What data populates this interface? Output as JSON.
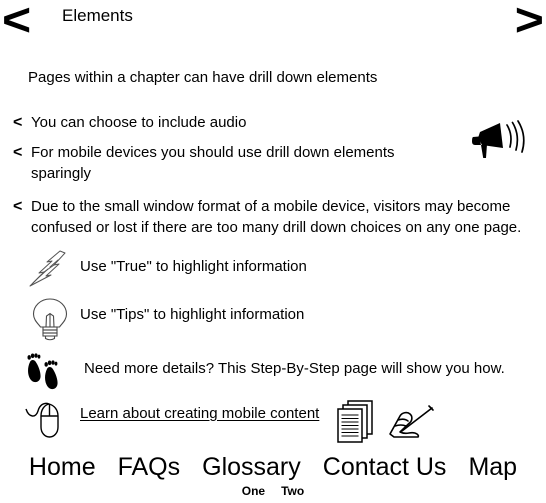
{
  "header": {
    "title": "Elements",
    "prev_arrow": "<",
    "next_arrow": ">",
    "prev_name": "previous-page-arrow",
    "next_name": "next-page-arrow"
  },
  "intro": {
    "text": "Pages within a chapter can have drill down elements"
  },
  "bullets": {
    "marker": "<",
    "items": [
      {
        "text": "You can choose to include audio"
      },
      {
        "text": "For mobile devices you should use drill down elements sparingly"
      },
      {
        "text": "Due to the small window format of a mobile device, visitors may become confused or lost if there are too many drill down choices on any one page."
      }
    ]
  },
  "icon_rows": [
    {
      "icon": "lightning-bolt-icon",
      "text": "Use \"True\" to highlight information"
    },
    {
      "icon": "light-bulb-icon",
      "text": "Use \"Tips\" to highlight information"
    },
    {
      "icon": "footprints-icon",
      "text": "Need more details? This Step-By-Step page will show you how."
    }
  ],
  "link_row": {
    "icon": "computer-mouse-icon",
    "link_text": "Learn about creating mobile content",
    "trailing_icons": [
      "stacked-documents-icon",
      "hand-writing-pen-icon"
    ]
  },
  "decor": {
    "megaphone_icon": "megaphone-icon"
  },
  "footer": {
    "items": [
      {
        "label": "Home"
      },
      {
        "label": "FAQs"
      },
      {
        "label": "Glossary"
      },
      {
        "label": "Contact Us"
      },
      {
        "label": "Map"
      }
    ],
    "subitems": [
      {
        "label": "One"
      },
      {
        "label": "Two"
      }
    ]
  },
  "colors": {
    "foreground": "#000000",
    "background": "#ffffff"
  }
}
